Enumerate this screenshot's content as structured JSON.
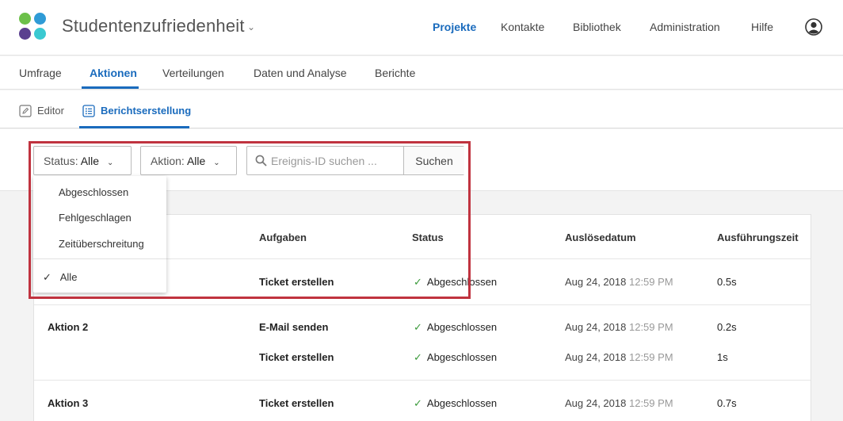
{
  "header": {
    "project_title": "Studentenzufriedenheit",
    "nav": [
      "Projekte",
      "Kontakte",
      "Bibliothek",
      "Administration",
      "Hilfe"
    ],
    "active_nav": "Projekte",
    "logo_colors": [
      "#6cc04a",
      "#2f9bd6",
      "#5a3f8f",
      "#3ac9d1"
    ]
  },
  "tabs": {
    "items": [
      "Umfrage",
      "Aktionen",
      "Verteilungen",
      "Daten und Analyse",
      "Berichte"
    ],
    "active": "Aktionen"
  },
  "subtabs": {
    "editor": "Editor",
    "reporting": "Berichtserstellung"
  },
  "filters": {
    "status_label": "Status:",
    "status_value": "Alle",
    "action_label": "Aktion:",
    "action_value": "Alle",
    "search_placeholder": "Ereignis-ID suchen ...",
    "search_button": "Suchen"
  },
  "dropdown": {
    "options": [
      "Abgeschlossen",
      "Fehlgeschlagen",
      "Zeitüberschreitung"
    ],
    "selected": "Alle"
  },
  "table": {
    "headers": [
      "Aufgaben",
      "Status",
      "Auslösedatum",
      "Ausführungszeit"
    ],
    "rows": [
      {
        "action": "",
        "task": "Ticket erstellen",
        "status": "Abgeschlossen",
        "date": "Aug 24, 2018",
        "time": "12:59 PM",
        "duration": "0.5s"
      },
      {
        "action": "Aktion 2",
        "task": "E-Mail senden",
        "status": "Abgeschlossen",
        "date": "Aug 24, 2018",
        "time": "12:59 PM",
        "duration": "0.2s"
      },
      {
        "action": "",
        "task": "Ticket erstellen",
        "status": "Abgeschlossen",
        "date": "Aug 24, 2018",
        "time": "12:59 PM",
        "duration": "1s"
      },
      {
        "action": "Aktion 3",
        "task": "Ticket erstellen",
        "status": "Abgeschlossen",
        "date": "Aug 24, 2018",
        "time": "12:59 PM",
        "duration": "0.7s"
      }
    ]
  },
  "colors": {
    "accent": "#1a6bbd",
    "success": "#3a9a3a",
    "highlight": "#c0333f"
  }
}
